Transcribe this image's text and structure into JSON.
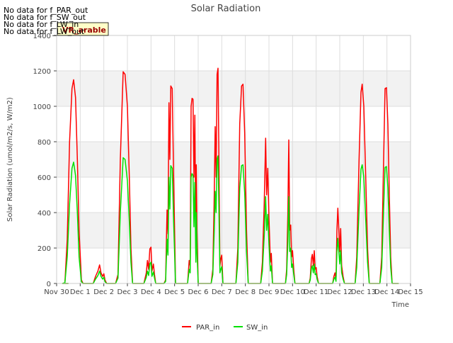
{
  "chart_data": {
    "type": "line",
    "title": "Solar Radiation",
    "xlabel": "Time",
    "ylabel": "Solar Radiation (umol/m2/s, W/m2)",
    "ylim": [
      0,
      1400
    ],
    "xlim": [
      0,
      15
    ],
    "yticks": [
      0,
      200,
      400,
      600,
      800,
      1000,
      1200,
      1400
    ],
    "xtick_labels": [
      "Nov 30",
      "Dec 1",
      "Dec 2",
      "Dec 3",
      "Dec 4",
      "Dec 5",
      "Dec 6",
      "Dec 7",
      "Dec 8",
      "Dec 9",
      "Dec 10",
      "Dec 11",
      "Dec 12",
      "Dec 13",
      "Dec 14",
      "Dec 15"
    ],
    "x_units": "days since Nov 30",
    "grid": true,
    "legend_position": "bottom-center",
    "notes": [
      "No data for f_PAR_out",
      "No data for f_SW_out",
      "No data for f_LW_in",
      "No data for f_LW_out"
    ],
    "annotation_label": "VR_arable",
    "series": [
      {
        "name": "PAR_in",
        "color": "#ff0000",
        "points": [
          [
            0.25,
            0
          ],
          [
            0.35,
            5
          ],
          [
            0.45,
            250
          ],
          [
            0.55,
            800
          ],
          [
            0.65,
            1100
          ],
          [
            0.72,
            1150
          ],
          [
            0.8,
            1050
          ],
          [
            0.88,
            700
          ],
          [
            0.95,
            300
          ],
          [
            1.05,
            20
          ],
          [
            1.12,
            0
          ],
          [
            1.55,
            0
          ],
          [
            1.65,
            40
          ],
          [
            1.75,
            70
          ],
          [
            1.82,
            105
          ],
          [
            1.88,
            60
          ],
          [
            1.95,
            40
          ],
          [
            2.0,
            55
          ],
          [
            2.05,
            20
          ],
          [
            2.12,
            0
          ],
          [
            2.5,
            0
          ],
          [
            2.6,
            50
          ],
          [
            2.7,
            700
          ],
          [
            2.82,
            1195
          ],
          [
            2.9,
            1180
          ],
          [
            3.0,
            1000
          ],
          [
            3.08,
            600
          ],
          [
            3.15,
            200
          ],
          [
            3.22,
            0
          ],
          [
            3.7,
            0
          ],
          [
            3.8,
            60
          ],
          [
            3.85,
            130
          ],
          [
            3.9,
            80
          ],
          [
            3.95,
            195
          ],
          [
            4.0,
            205
          ],
          [
            4.04,
            70
          ],
          [
            4.1,
            110
          ],
          [
            4.15,
            50
          ],
          [
            4.2,
            0
          ],
          [
            4.55,
            0
          ],
          [
            4.62,
            20
          ],
          [
            4.68,
            415
          ],
          [
            4.72,
            280
          ],
          [
            4.76,
            1020
          ],
          [
            4.8,
            700
          ],
          [
            4.84,
            1115
          ],
          [
            4.9,
            1100
          ],
          [
            4.96,
            600
          ],
          [
            5.04,
            0
          ],
          [
            5.55,
            0
          ],
          [
            5.62,
            130
          ],
          [
            5.66,
            100
          ],
          [
            5.7,
            1000
          ],
          [
            5.74,
            1045
          ],
          [
            5.78,
            1040
          ],
          [
            5.82,
            600
          ],
          [
            5.86,
            950
          ],
          [
            5.9,
            200
          ],
          [
            5.92,
            670
          ],
          [
            5.95,
            300
          ],
          [
            6.0,
            0
          ],
          [
            6.55,
            0
          ],
          [
            6.62,
            80
          ],
          [
            6.68,
            500
          ],
          [
            6.72,
            885
          ],
          [
            6.76,
            600
          ],
          [
            6.8,
            1180
          ],
          [
            6.84,
            1215
          ],
          [
            6.88,
            700
          ],
          [
            6.92,
            100
          ],
          [
            6.96,
            140
          ],
          [
            7.0,
            160
          ],
          [
            7.05,
            0
          ],
          [
            7.6,
            0
          ],
          [
            7.68,
            200
          ],
          [
            7.76,
            900
          ],
          [
            7.84,
            1115
          ],
          [
            7.9,
            1125
          ],
          [
            7.97,
            850
          ],
          [
            8.05,
            300
          ],
          [
            8.12,
            0
          ],
          [
            8.65,
            0
          ],
          [
            8.72,
            120
          ],
          [
            8.8,
            450
          ],
          [
            8.86,
            820
          ],
          [
            8.9,
            500
          ],
          [
            8.95,
            650
          ],
          [
            9.0,
            370
          ],
          [
            9.06,
            120
          ],
          [
            9.1,
            170
          ],
          [
            9.15,
            0
          ],
          [
            9.7,
            0
          ],
          [
            9.75,
            80
          ],
          [
            9.8,
            400
          ],
          [
            9.84,
            810
          ],
          [
            9.88,
            300
          ],
          [
            9.92,
            330
          ],
          [
            9.96,
            150
          ],
          [
            10.0,
            185
          ],
          [
            10.05,
            80
          ],
          [
            10.1,
            0
          ],
          [
            10.7,
            0
          ],
          [
            10.75,
            30
          ],
          [
            10.8,
            140
          ],
          [
            10.84,
            165
          ],
          [
            10.88,
            100
          ],
          [
            10.92,
            185
          ],
          [
            10.96,
            80
          ],
          [
            11.0,
            90
          ],
          [
            11.04,
            40
          ],
          [
            11.1,
            0
          ],
          [
            11.7,
            0
          ],
          [
            11.75,
            40
          ],
          [
            11.8,
            60
          ],
          [
            11.84,
            20
          ],
          [
            11.88,
            300
          ],
          [
            11.92,
            425
          ],
          [
            11.96,
            300
          ],
          [
            12.0,
            180
          ],
          [
            12.04,
            310
          ],
          [
            12.08,
            100
          ],
          [
            12.14,
            40
          ],
          [
            12.2,
            0
          ],
          [
            12.65,
            0
          ],
          [
            12.72,
            150
          ],
          [
            12.82,
            700
          ],
          [
            12.9,
            1080
          ],
          [
            12.95,
            1125
          ],
          [
            13.02,
            1000
          ],
          [
            13.1,
            600
          ],
          [
            13.18,
            200
          ],
          [
            13.25,
            0
          ],
          [
            13.7,
            0
          ],
          [
            13.78,
            150
          ],
          [
            13.86,
            700
          ],
          [
            13.92,
            1100
          ],
          [
            13.98,
            1105
          ],
          [
            14.04,
            900
          ],
          [
            14.1,
            500
          ],
          [
            14.16,
            150
          ],
          [
            14.22,
            0
          ]
        ]
      },
      {
        "name": "SW_in",
        "color": "#00e000",
        "points": [
          [
            0.25,
            0
          ],
          [
            0.35,
            5
          ],
          [
            0.45,
            150
          ],
          [
            0.55,
            450
          ],
          [
            0.65,
            650
          ],
          [
            0.72,
            685
          ],
          [
            0.8,
            610
          ],
          [
            0.88,
            400
          ],
          [
            0.95,
            150
          ],
          [
            1.05,
            10
          ],
          [
            1.12,
            0
          ],
          [
            1.55,
            0
          ],
          [
            1.65,
            25
          ],
          [
            1.75,
            45
          ],
          [
            1.82,
            70
          ],
          [
            1.88,
            40
          ],
          [
            1.95,
            25
          ],
          [
            2.0,
            35
          ],
          [
            2.05,
            10
          ],
          [
            2.12,
            0
          ],
          [
            2.5,
            0
          ],
          [
            2.6,
            30
          ],
          [
            2.7,
            400
          ],
          [
            2.82,
            710
          ],
          [
            2.9,
            700
          ],
          [
            3.0,
            580
          ],
          [
            3.08,
            350
          ],
          [
            3.15,
            120
          ],
          [
            3.22,
            0
          ],
          [
            3.7,
            0
          ],
          [
            3.8,
            35
          ],
          [
            3.85,
            70
          ],
          [
            3.9,
            45
          ],
          [
            3.95,
            110
          ],
          [
            4.0,
            120
          ],
          [
            4.04,
            40
          ],
          [
            4.1,
            65
          ],
          [
            4.15,
            30
          ],
          [
            4.2,
            0
          ],
          [
            4.55,
            0
          ],
          [
            4.62,
            12
          ],
          [
            4.68,
            250
          ],
          [
            4.72,
            160
          ],
          [
            4.76,
            600
          ],
          [
            4.8,
            420
          ],
          [
            4.84,
            665
          ],
          [
            4.9,
            650
          ],
          [
            4.96,
            350
          ],
          [
            5.04,
            0
          ],
          [
            5.55,
            0
          ],
          [
            5.62,
            80
          ],
          [
            5.66,
            60
          ],
          [
            5.7,
            600
          ],
          [
            5.74,
            620
          ],
          [
            5.78,
            610
          ],
          [
            5.82,
            320
          ],
          [
            5.86,
            570
          ],
          [
            5.9,
            120
          ],
          [
            5.92,
            400
          ],
          [
            5.95,
            180
          ],
          [
            6.0,
            0
          ],
          [
            6.55,
            0
          ],
          [
            6.62,
            50
          ],
          [
            6.68,
            300
          ],
          [
            6.72,
            520
          ],
          [
            6.76,
            400
          ],
          [
            6.8,
            700
          ],
          [
            6.84,
            720
          ],
          [
            6.88,
            420
          ],
          [
            6.92,
            60
          ],
          [
            6.96,
            80
          ],
          [
            7.0,
            95
          ],
          [
            7.05,
            0
          ],
          [
            7.6,
            0
          ],
          [
            7.68,
            120
          ],
          [
            7.76,
            540
          ],
          [
            7.84,
            665
          ],
          [
            7.9,
            670
          ],
          [
            7.97,
            510
          ],
          [
            8.05,
            180
          ],
          [
            8.12,
            0
          ],
          [
            8.65,
            0
          ],
          [
            8.72,
            70
          ],
          [
            8.8,
            270
          ],
          [
            8.86,
            490
          ],
          [
            8.9,
            300
          ],
          [
            8.95,
            390
          ],
          [
            9.0,
            220
          ],
          [
            9.06,
            70
          ],
          [
            9.1,
            100
          ],
          [
            9.15,
            0
          ],
          [
            9.7,
            0
          ],
          [
            9.75,
            50
          ],
          [
            9.8,
            240
          ],
          [
            9.84,
            490
          ],
          [
            9.88,
            180
          ],
          [
            9.92,
            200
          ],
          [
            9.96,
            90
          ],
          [
            10.0,
            110
          ],
          [
            10.05,
            50
          ],
          [
            10.1,
            0
          ],
          [
            10.7,
            0
          ],
          [
            10.75,
            20
          ],
          [
            10.8,
            85
          ],
          [
            10.84,
            100
          ],
          [
            10.88,
            60
          ],
          [
            10.92,
            110
          ],
          [
            10.96,
            50
          ],
          [
            11.0,
            55
          ],
          [
            11.04,
            25
          ],
          [
            11.1,
            0
          ],
          [
            11.7,
            0
          ],
          [
            11.75,
            25
          ],
          [
            11.8,
            35
          ],
          [
            11.84,
            12
          ],
          [
            11.88,
            180
          ],
          [
            11.92,
            255
          ],
          [
            11.96,
            180
          ],
          [
            12.0,
            110
          ],
          [
            12.04,
            185
          ],
          [
            12.08,
            60
          ],
          [
            12.14,
            25
          ],
          [
            12.2,
            0
          ],
          [
            12.65,
            0
          ],
          [
            12.72,
            90
          ],
          [
            12.82,
            420
          ],
          [
            12.9,
            645
          ],
          [
            12.95,
            670
          ],
          [
            13.02,
            600
          ],
          [
            13.1,
            360
          ],
          [
            13.18,
            120
          ],
          [
            13.25,
            0
          ],
          [
            13.7,
            0
          ],
          [
            13.78,
            90
          ],
          [
            13.86,
            420
          ],
          [
            13.92,
            655
          ],
          [
            13.98,
            660
          ],
          [
            14.04,
            540
          ],
          [
            14.1,
            300
          ],
          [
            14.16,
            90
          ],
          [
            14.22,
            0
          ]
        ]
      }
    ]
  }
}
